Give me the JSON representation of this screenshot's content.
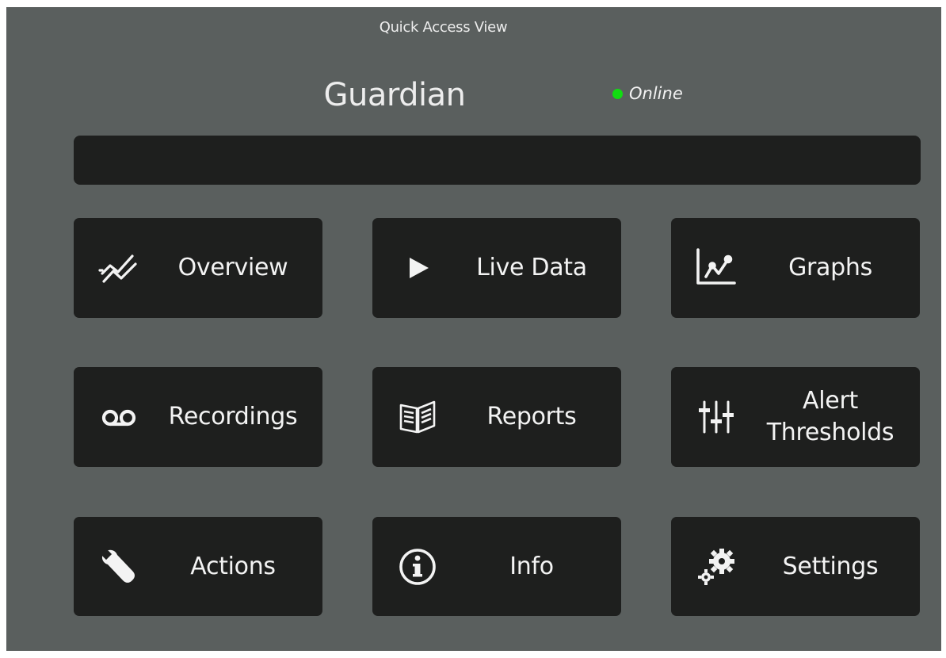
{
  "header": {
    "view_title": "Quick Access View",
    "device_name": "Guardian",
    "status_label": "Online",
    "status_color": "#11dd11"
  },
  "colors": {
    "background": "#5a5f5e",
    "tile": "#1e1f1e",
    "text": "#f3f3f3"
  },
  "tiles": [
    {
      "label": "Overview",
      "icon": "trend-lines-icon"
    },
    {
      "label": "Live Data",
      "icon": "play-icon"
    },
    {
      "label": "Graphs",
      "icon": "line-graph-icon"
    },
    {
      "label": "Recordings",
      "icon": "voicemail-icon"
    },
    {
      "label": "Reports",
      "icon": "open-book-icon"
    },
    {
      "label": "Alert Thresholds",
      "icon": "sliders-icon"
    },
    {
      "label": "Actions",
      "icon": "wrench-icon"
    },
    {
      "label": "Info",
      "icon": "info-icon"
    },
    {
      "label": "Settings",
      "icon": "gears-icon"
    }
  ]
}
